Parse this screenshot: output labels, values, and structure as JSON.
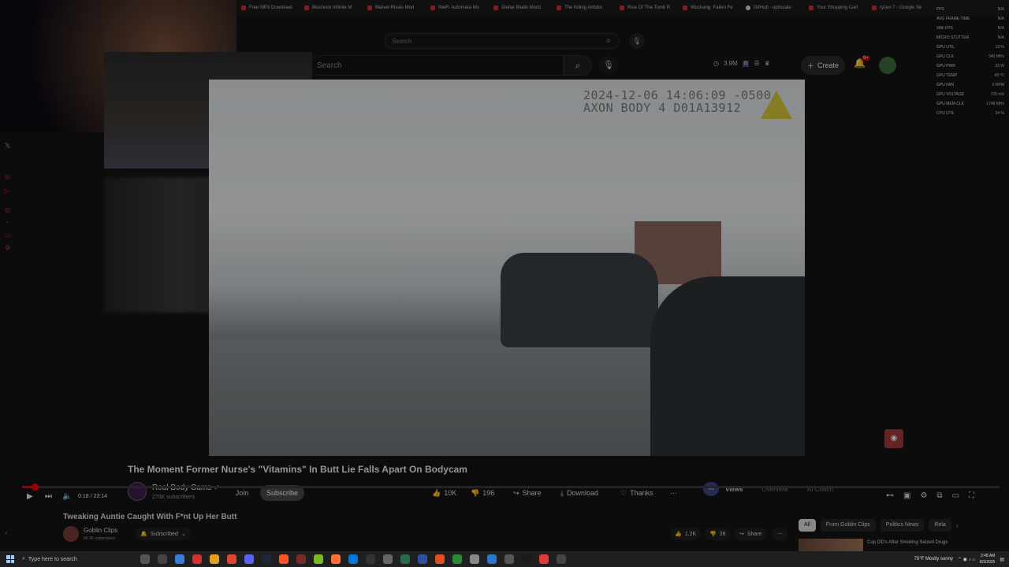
{
  "browser_tabs": [
    "Free MP3 Download",
    "Bioshock Infinite M",
    "Marvel Rivals Mod",
    "NieR: Automata Mo",
    "Stellar Blade Mods",
    "The Killing Antidot",
    "Rise Of The Tomb R",
    "Wuchang: Fallen Fe",
    "GitHub - optiscale",
    "Your Shopping Cart",
    "ryzen 7 - Google Se"
  ],
  "outer_search": {
    "placeholder": "Search"
  },
  "yt_header": {
    "search_placeholder": "Search",
    "view_count": "3.9M",
    "create_label": "Create",
    "notif_count": "9+"
  },
  "video": {
    "timestamp_line1": "2024-12-06 14:06:09 -0500",
    "timestamp_line2": "AXON BODY 4 D01A13912"
  },
  "video_info": {
    "title": "The Moment Former Nurse's \"Vitamins\" In Butt Lie Falls Apart On Bodycam",
    "channel_name": "Real Body Cams",
    "channel_subs": "276K subscribers",
    "join_label": "Join",
    "subscribe_label": "Subscribe",
    "likes": "10K",
    "dislikes": "196",
    "share_label": "Share",
    "download_label": "Download",
    "thanks_label": "Thanks"
  },
  "right_tabs": {
    "ai_badge": "AI",
    "views": "Views",
    "overview": "Overview",
    "ai_coach": "AI Coach"
  },
  "player": {
    "time": "0:18 / 23:14",
    "progress_fraction": 0.013
  },
  "second_video": {
    "title": "Tweaking Auntie Caught With F*nt Up Her Butt",
    "channel": "Goblin Clips",
    "subs": "89.3K subscribers",
    "subscribed_label": "Subscribed",
    "likes": "1.2K",
    "dislikes": "28",
    "share_label": "Share"
  },
  "chips": [
    "All",
    "From Goblin Clips",
    "Politics News",
    "Rela"
  ],
  "recommendation": {
    "title": "Cop OD's After Smoking Seized Drugs"
  },
  "perf_overlay": [
    {
      "label": "AVG FRAME TIME",
      "value": "N/A"
    },
    {
      "label": "99th FPS",
      "value": "N/A"
    },
    {
      "label": "MICRO STUTTER",
      "value": "N/A"
    },
    {
      "label": "GPU UTIL",
      "value": "13 %"
    },
    {
      "label": "GPU CLK",
      "value": "340 MHz"
    },
    {
      "label": "GPU PWR",
      "value": "33 W"
    },
    {
      "label": "GPU TEMP",
      "value": "49 °C"
    },
    {
      "label": "GPU FAN",
      "value": "0 RPM"
    },
    {
      "label": "GPU VOLTAGE",
      "value": "725 mV"
    },
    {
      "label": "GPU MEM CLK",
      "value": "1748 MHz"
    },
    {
      "label": "CPU UTIL",
      "value": "34 %"
    }
  ],
  "perf_top": {
    "fps_label": "FPS",
    "fps_value": "N/A"
  },
  "taskbar": {
    "search_placeholder": "Type here to search",
    "weather": "75°F  Mostly sunny",
    "time": "3:48 AM",
    "date": "8/3/2025"
  },
  "colors": {
    "accent_red": "#ff0000",
    "yt_bg": "#0f0f0f"
  }
}
